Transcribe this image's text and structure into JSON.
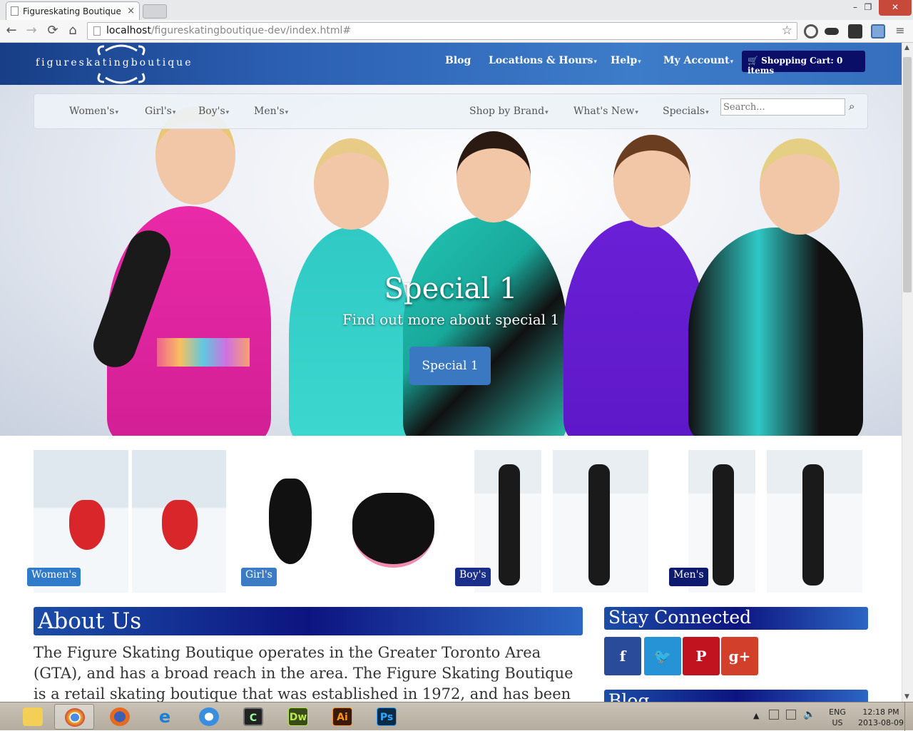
{
  "browser": {
    "tab_title": "Figureskating Boutique",
    "tab_close": "×",
    "url_host": "localhost",
    "url_path": "/figureskatingboutique-dev/index.html#",
    "window_controls": [
      "–",
      "❐",
      "✕"
    ]
  },
  "site": {
    "logo_text": "figureskatingboutique",
    "top_nav": [
      {
        "label": "Blog",
        "caret": false
      },
      {
        "label": "Locations & Hours",
        "caret": true
      },
      {
        "label": "Help",
        "caret": true
      },
      {
        "label": "My Account",
        "caret": true
      }
    ],
    "cart_label": "Shopping Cart: 0 items",
    "menu_left": [
      "Women's",
      "Girl's",
      "Boy's",
      "Men's"
    ],
    "menu_right": [
      "Shop by Brand",
      "What's New",
      "Specials"
    ],
    "search_placeholder": "Search...",
    "carousel": {
      "title": "Special 1",
      "subtitle": "Find out more about special 1",
      "button": "Special 1",
      "slide_count": 4,
      "active_slide": 1
    },
    "categories": [
      {
        "label": "Women's",
        "color": "#2f7bc9"
      },
      {
        "label": "Girl's",
        "color": "#3b7cc4"
      },
      {
        "label": "Boy's",
        "color": "#1a2f8a"
      },
      {
        "label": "Men's",
        "color": "#0e1a6e"
      }
    ],
    "about": {
      "heading": "About Us",
      "text": "The Figure Skating Boutique operates in the Greater Toronto Area (GTA), and has a broad reach in the area. The Figure Skating Boutique is a retail skating boutique that was established in 1972, and has been in the same"
    },
    "stay_connected": {
      "heading": "Stay Connected",
      "social": [
        {
          "name": "facebook",
          "glyph": "f",
          "color": "#2a4a9a"
        },
        {
          "name": "twitter",
          "glyph": "🐦",
          "color": "#2593d6"
        },
        {
          "name": "pinterest",
          "glyph": "P",
          "color": "#c1121f"
        },
        {
          "name": "google-plus",
          "glyph": "g+",
          "color": "#d2402c"
        }
      ]
    },
    "blog_heading": "Blog"
  },
  "taskbar": {
    "apps": [
      "folder",
      "chrome",
      "firefox",
      "ie",
      "safari",
      "terminal",
      "Dw",
      "Ai",
      "Ps"
    ],
    "lang": "ENG",
    "region": "US",
    "time": "12:18 PM",
    "date": "2013-08-09"
  },
  "colors": {
    "header_blue": "#2b5eb1",
    "cart_navy": "#0b0e67",
    "button_blue": "#3b78c2"
  }
}
